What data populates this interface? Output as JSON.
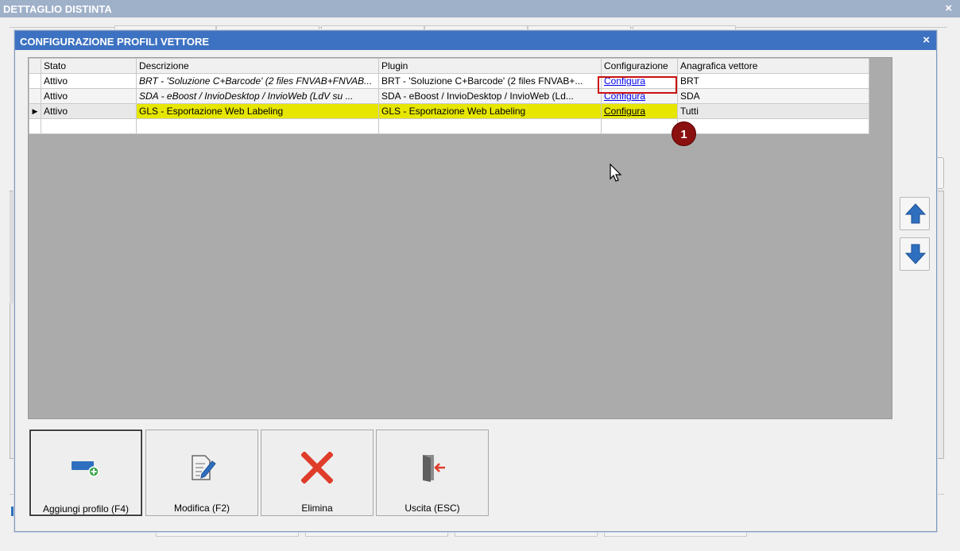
{
  "parent_window": {
    "title": "DETTAGLIO DISTINTA",
    "close": "×"
  },
  "dialog": {
    "title": "CONFIGURAZIONE PROFILI VETTORE",
    "close": "×"
  },
  "grid": {
    "columns": [
      "Stato",
      "Descrizione",
      "Plugin",
      "Configurazione",
      "Anagrafica vettore"
    ],
    "rows": [
      {
        "stato": "Attivo",
        "descrizione": "BRT - 'Soluzione C+Barcode' (2 files FNVAB+FNVAB...",
        "plugin": "BRT - 'Soluzione C+Barcode' (2 files FNVAB+...",
        "configurazione": "Configura",
        "vettore": "BRT"
      },
      {
        "stato": "Attivo",
        "descrizione": "SDA - eBoost / InvioDesktop / InvioWeb (LdV su ...",
        "plugin": "SDA - eBoost / InvioDesktop / InvioWeb (Ld...",
        "configurazione": "Configura",
        "vettore": "SDA"
      },
      {
        "stato": "Attivo",
        "descrizione": "GLS - Esportazione Web Labeling",
        "plugin": "GLS - Esportazione Web Labeling",
        "configurazione": "Configura",
        "vettore": "Tutti"
      }
    ]
  },
  "marker": "1",
  "buttons": {
    "add": "Aggiungi profilo (F4)",
    "edit": "Modifica (F2)",
    "delete": "Elimina",
    "exit": "Uscita (ESC)"
  },
  "icons": {
    "add": "add-profile-icon",
    "edit": "edit-document-icon",
    "delete": "red-x-icon",
    "exit": "exit-door-icon",
    "up": "arrow-up-icon",
    "down": "arrow-down-icon"
  },
  "colors": {
    "dialog_title_bg": "#3d72c2",
    "highlight_row": "#e6e600",
    "marker": "#8b1010",
    "callout_border": "#cc1010"
  }
}
